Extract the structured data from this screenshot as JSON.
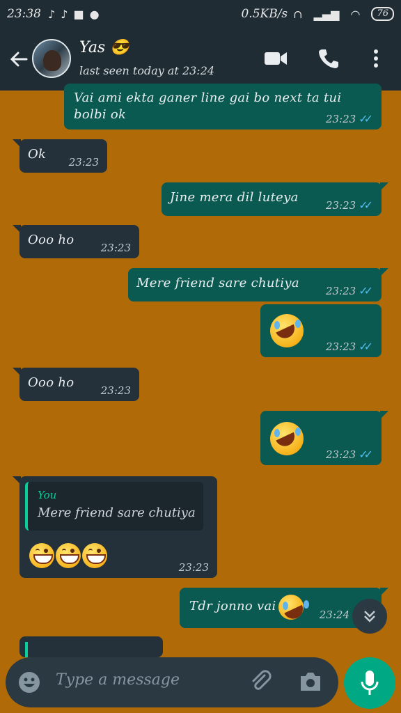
{
  "status_bar": {
    "time": "23:38",
    "net_speed": "0.5KB/s",
    "battery": "76"
  },
  "header": {
    "contact_name": "Yas 😎",
    "last_seen": "last seen today at 23:24"
  },
  "messages": [
    {
      "dir": "out",
      "text": "Vai ami ekta ganer line gai bo next ta tui",
      "text2": "bolbi ok",
      "time": "23:23"
    },
    {
      "dir": "in",
      "text": "Ok",
      "time": "23:23"
    },
    {
      "dir": "out",
      "text": "Jine mera dil luteya",
      "time": "23:23"
    },
    {
      "dir": "in",
      "text": "Ooo ho",
      "time": "23:23"
    },
    {
      "dir": "out",
      "text": "Mere friend sare chutiya",
      "time": "23:23"
    },
    {
      "dir": "out",
      "text": "",
      "emoji": "rolling-on-floor-laughing",
      "time": "23:23"
    },
    {
      "dir": "in",
      "text": "Ooo ho",
      "time": "23:23"
    },
    {
      "dir": "out",
      "text": "",
      "emoji": "rolling-on-floor-laughing",
      "time": "23:23"
    },
    {
      "dir": "in",
      "reply_author": "You",
      "reply_text": "Mere friend sare chutiya",
      "emoji": "grinning x3",
      "time": "23:23"
    },
    {
      "dir": "out",
      "text": "Tdr jonno vai",
      "time": "23:24"
    }
  ],
  "input": {
    "placeholder": "Type a message"
  },
  "colors": {
    "header": "#1f2c33",
    "wallpaper": "#b06b08",
    "outgoing": "#0a5a52",
    "incoming": "#24313a",
    "accent": "#00a884",
    "read_tick": "#53bdeb"
  }
}
